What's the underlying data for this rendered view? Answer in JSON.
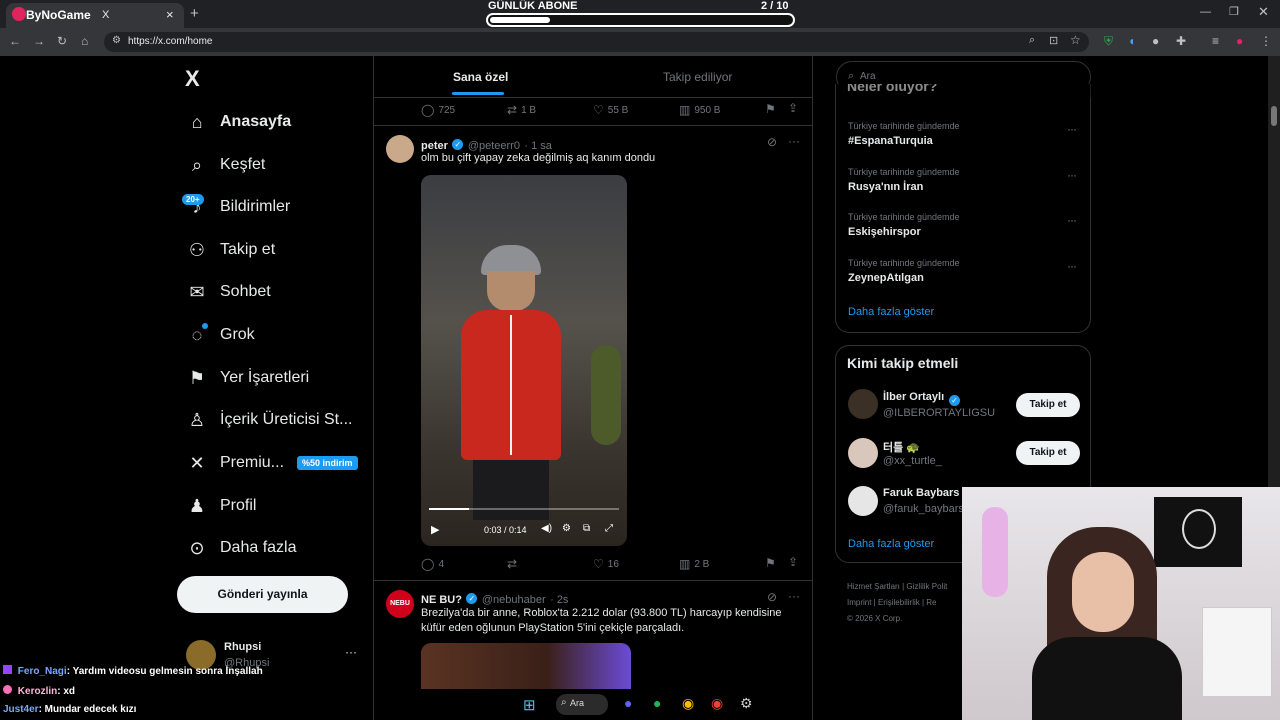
{
  "browser": {
    "tab_title": "X",
    "tab_close": "×",
    "new_tab": "+",
    "url": "https://x.com/home",
    "overlay_logo": "ByNoGame"
  },
  "sub_goal": {
    "title": "GÜNLÜK ABONE",
    "count": "2  / 10",
    "progress": 0.2
  },
  "nav": {
    "logo": "X",
    "items": [
      {
        "label": "Anasayfa",
        "icon": "home-icon",
        "active": true
      },
      {
        "label": "Keşfet",
        "icon": "search-icon"
      },
      {
        "label": "Bildirimler",
        "icon": "bell-icon",
        "badge": "20+"
      },
      {
        "label": "Takip et",
        "icon": "follow-icon"
      },
      {
        "label": "Sohbet",
        "icon": "mail-icon"
      },
      {
        "label": "Grok",
        "icon": "grok-icon"
      },
      {
        "label": "Yer İşaretleri",
        "icon": "bookmark-icon"
      },
      {
        "label": "İçerik Üreticisi St...",
        "icon": "creator-icon"
      },
      {
        "label": "Premiu...",
        "icon": "x-premium-icon",
        "badge": "%50 indirim"
      },
      {
        "label": "Profil",
        "icon": "profile-icon"
      },
      {
        "label": "Daha fazla",
        "icon": "more-icon"
      }
    ],
    "post_button": "Gönderi yayınla",
    "account_name": "Rhupsi",
    "account_handle": "@Rhupsi"
  },
  "feed": {
    "tabs": [
      "Sana özel",
      "Takip ediliyor"
    ],
    "prev_actions": {
      "replies": "725",
      "reposts": "1 B",
      "likes": "55 B",
      "views": "950 B"
    },
    "tweet1": {
      "name": "peter",
      "handle": "@peteerr0",
      "time": "· 1 sa",
      "text": "olm bu çift yapay zeka değilmiş aq kanım dondu",
      "video_time": "0:03 / 0:14",
      "video_progress": 0.21,
      "replies": "4",
      "reposts": "",
      "likes": "16",
      "views": "2 B"
    },
    "tweet2": {
      "name": "NE BU?",
      "handle": "@nebuhaber",
      "time": "· 2s",
      "avatar_text": "NEBU",
      "text": "Brezilya'da bir anne, Roblox'ta 2.212 dolar (93.800 TL) harcayıp kendisine küfür eden oğlunun PlayStation 5'ini çekiçle parçaladı."
    }
  },
  "sidebar": {
    "search_placeholder": "Ara",
    "trends_title": "Neler oluyor?",
    "trends": [
      {
        "meta": "Türkiye tarihinde gündemde",
        "name": "#EspanaTurquia"
      },
      {
        "meta": "Türkiye tarihinde gündemde",
        "name": "Rusya'nın İran"
      },
      {
        "meta": "Türkiye tarihinde gündemde",
        "name": "Eskişehirspor"
      },
      {
        "meta": "Türkiye tarihinde gündemde",
        "name": "ZeynepAtılgan"
      }
    ],
    "show_more": "Daha fazla göster",
    "who_to_follow": "Kimi takip etmeli",
    "follow_suggestions": [
      {
        "name": "İlber Ortaylı",
        "handle": "@ILBERORTAYLIGSU",
        "button": "Takip et"
      },
      {
        "name": "터틀 🐢",
        "handle": "@xx_turtle_",
        "button": "Takip et"
      },
      {
        "name": "Faruk Baybars",
        "handle": "@faruk_baybars"
      }
    ],
    "show_more2": "Daha fazla göster",
    "footer_line1": "Hizmet Şartları  |  Gizlilik Polit",
    "footer_line2": "Imprint  |  Erişilebilirlik  |  Re",
    "footer_copy": "© 2026 X Corp."
  },
  "chat": [
    {
      "user": "Fero_Nagi",
      "msg": ": Yardım videosu gelmesin sonra İnşallah",
      "color": "#7aa7ff"
    },
    {
      "user": "Kerozlin",
      "msg": ": xd",
      "color": "#ffb3d9"
    },
    {
      "user": "Just4er",
      "msg": ": Mundar edecek kızı",
      "color": "#7aa7ff"
    }
  ],
  "taskbar": {
    "search": "Ara"
  }
}
